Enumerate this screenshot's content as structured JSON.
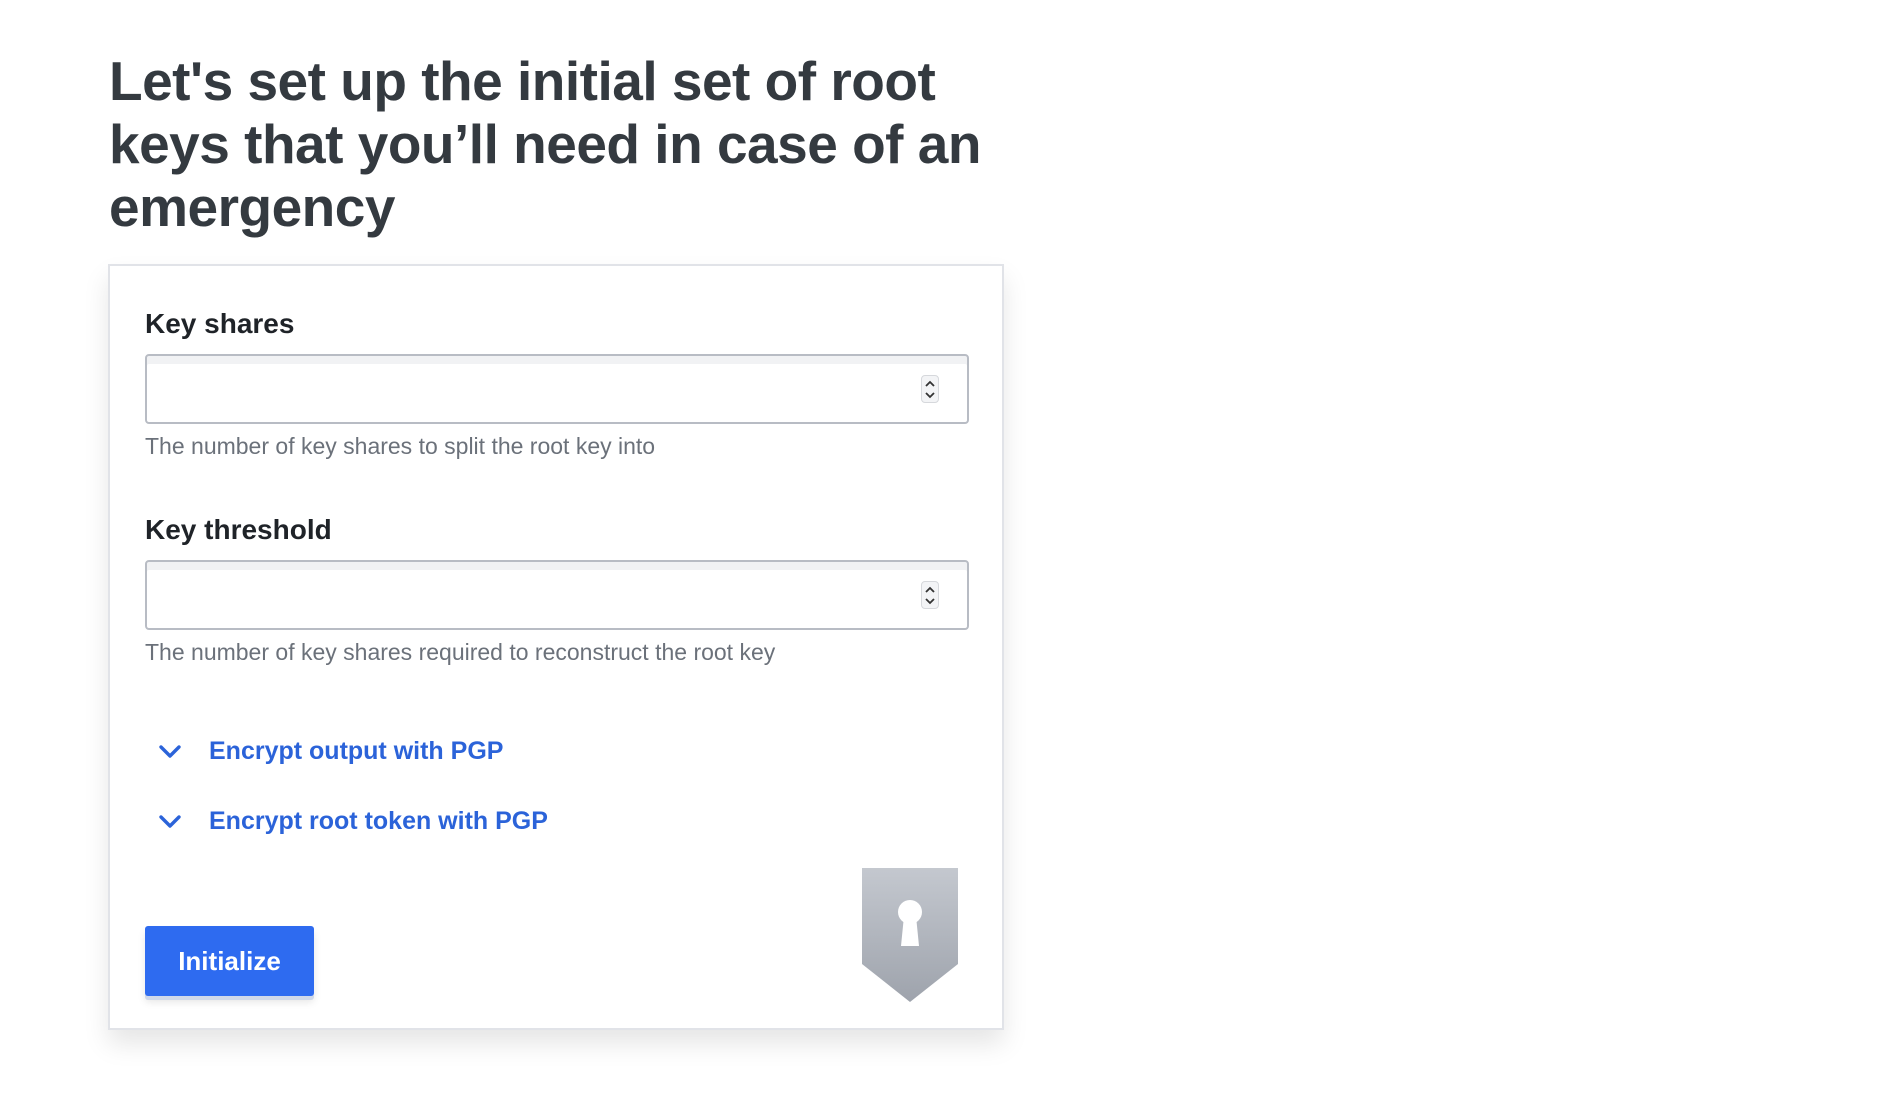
{
  "page": {
    "title": "Let's set up the initial set of root keys that you’ll need in case of an emergency"
  },
  "form": {
    "key_shares": {
      "label": "Key shares",
      "value": "",
      "help": "The number of key shares to split the root key into"
    },
    "key_threshold": {
      "label": "Key threshold",
      "value": "",
      "help": "The number of key shares required to reconstruct the root key"
    },
    "toggles": [
      {
        "label": "Encrypt output with PGP",
        "icon": "chevron-down-icon"
      },
      {
        "label": "Encrypt root token with PGP",
        "icon": "chevron-down-icon"
      }
    ],
    "submit_label": "Initialize"
  },
  "illustration": {
    "icon": "shield-keyhole-icon"
  },
  "colors": {
    "accent": "#2e6bf0",
    "link": "#2b63d9",
    "title": "#343a40",
    "help": "#6b717a"
  }
}
